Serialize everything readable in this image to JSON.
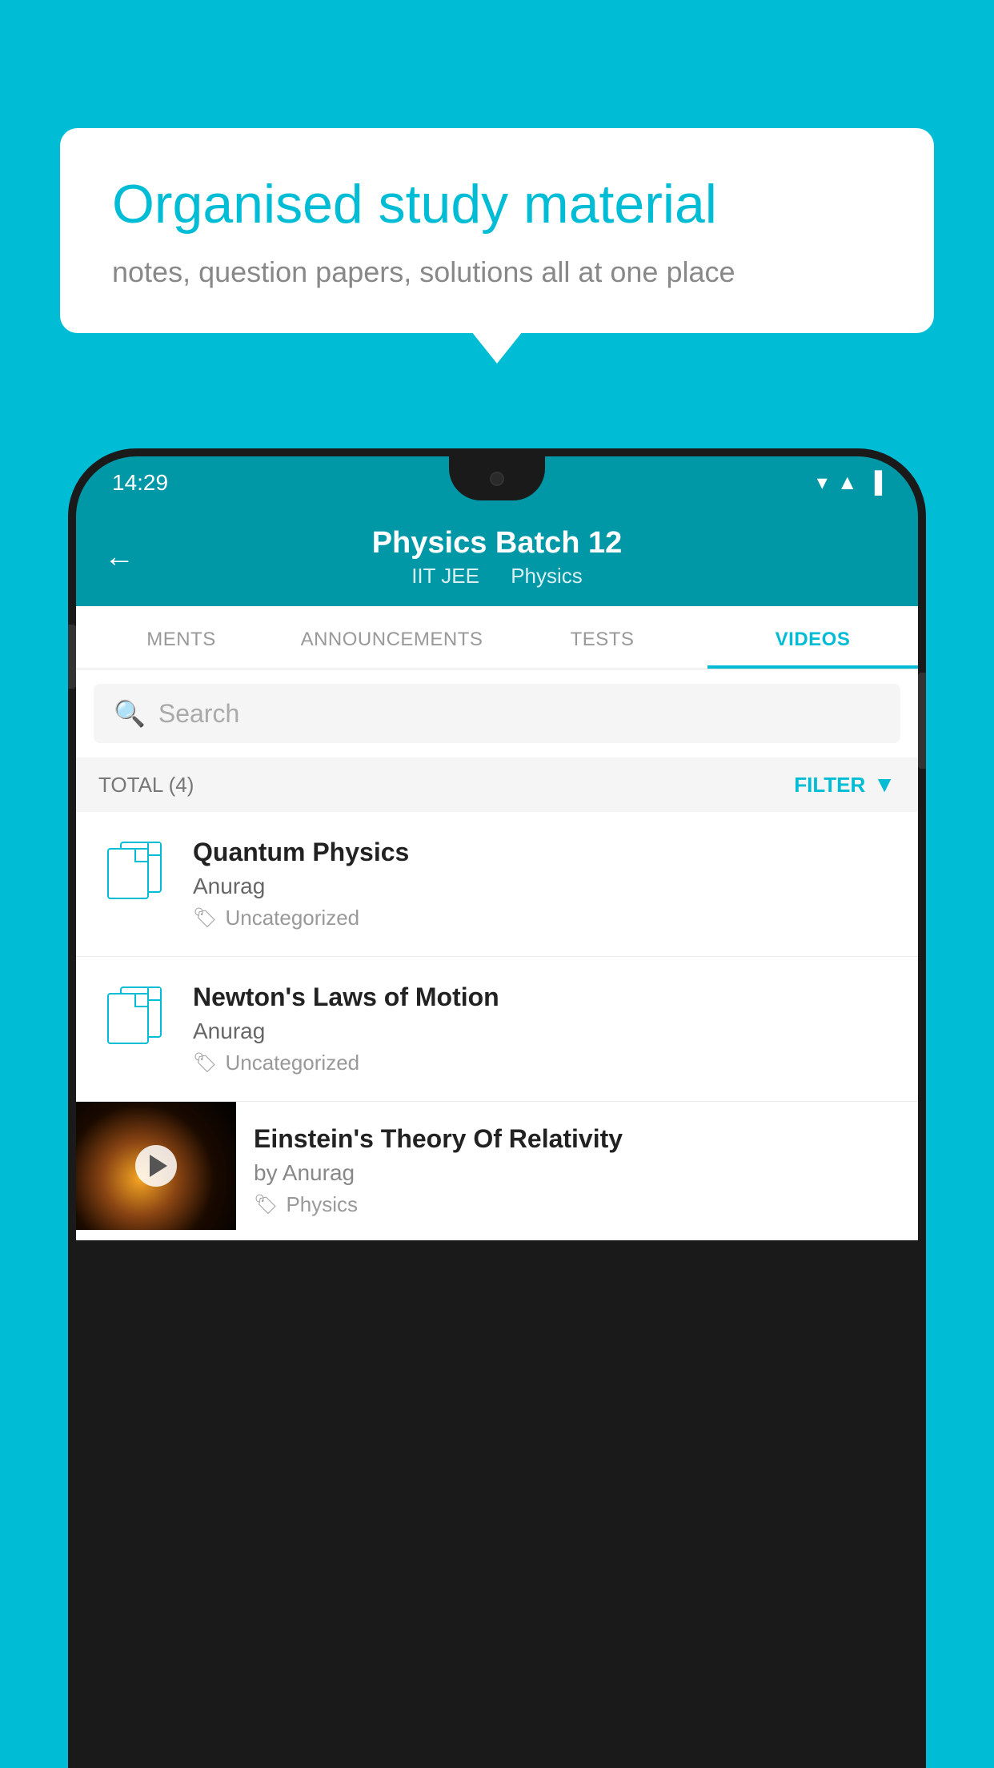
{
  "background_color": "#00bcd4",
  "speech_bubble": {
    "title": "Organised study material",
    "subtitle": "notes, question papers, solutions all at one place"
  },
  "phone": {
    "status_bar": {
      "time": "14:29",
      "icons": [
        "wifi",
        "signal",
        "battery"
      ]
    },
    "header": {
      "title": "Physics Batch 12",
      "subtitle_part1": "IIT JEE",
      "subtitle_part2": "Physics",
      "back_label": "←"
    },
    "tabs": [
      {
        "label": "MENTS",
        "active": false
      },
      {
        "label": "ANNOUNCEMENTS",
        "active": false
      },
      {
        "label": "TESTS",
        "active": false
      },
      {
        "label": "VIDEOS",
        "active": true
      }
    ],
    "search": {
      "placeholder": "Search"
    },
    "filter_bar": {
      "total_label": "TOTAL (4)",
      "filter_button": "FILTER"
    },
    "items": [
      {
        "title": "Quantum Physics",
        "author": "Anurag",
        "tag": "Uncategorized",
        "type": "document"
      },
      {
        "title": "Newton's Laws of Motion",
        "author": "Anurag",
        "tag": "Uncategorized",
        "type": "document"
      },
      {
        "title": "Einstein's Theory Of Relativity",
        "author": "by Anurag",
        "tag": "Physics",
        "type": "video"
      }
    ]
  }
}
